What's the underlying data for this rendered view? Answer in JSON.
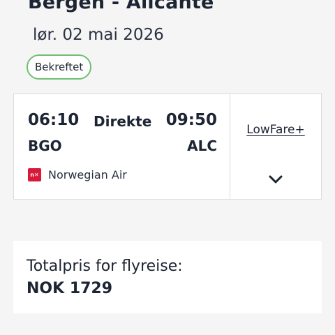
{
  "header": {
    "route": "Bergen - Alicante",
    "date": "lør. 02 mai 2026",
    "status": "Bekreftet",
    "status_color": "#6fbf73"
  },
  "flight": {
    "departure_time": "06:10",
    "arrival_time": "09:50",
    "stops": "Direkte",
    "departure_code": "BGO",
    "arrival_code": "ALC",
    "airline_name": "Norwegian Air",
    "airline_logo_text": "n✕",
    "airline_color": "#d81939",
    "fare_type": "LowFare+",
    "expand_icon": "chevron-down-icon"
  },
  "total": {
    "label": "Totalpris for flyreise:",
    "amount": "NOK 1729"
  }
}
